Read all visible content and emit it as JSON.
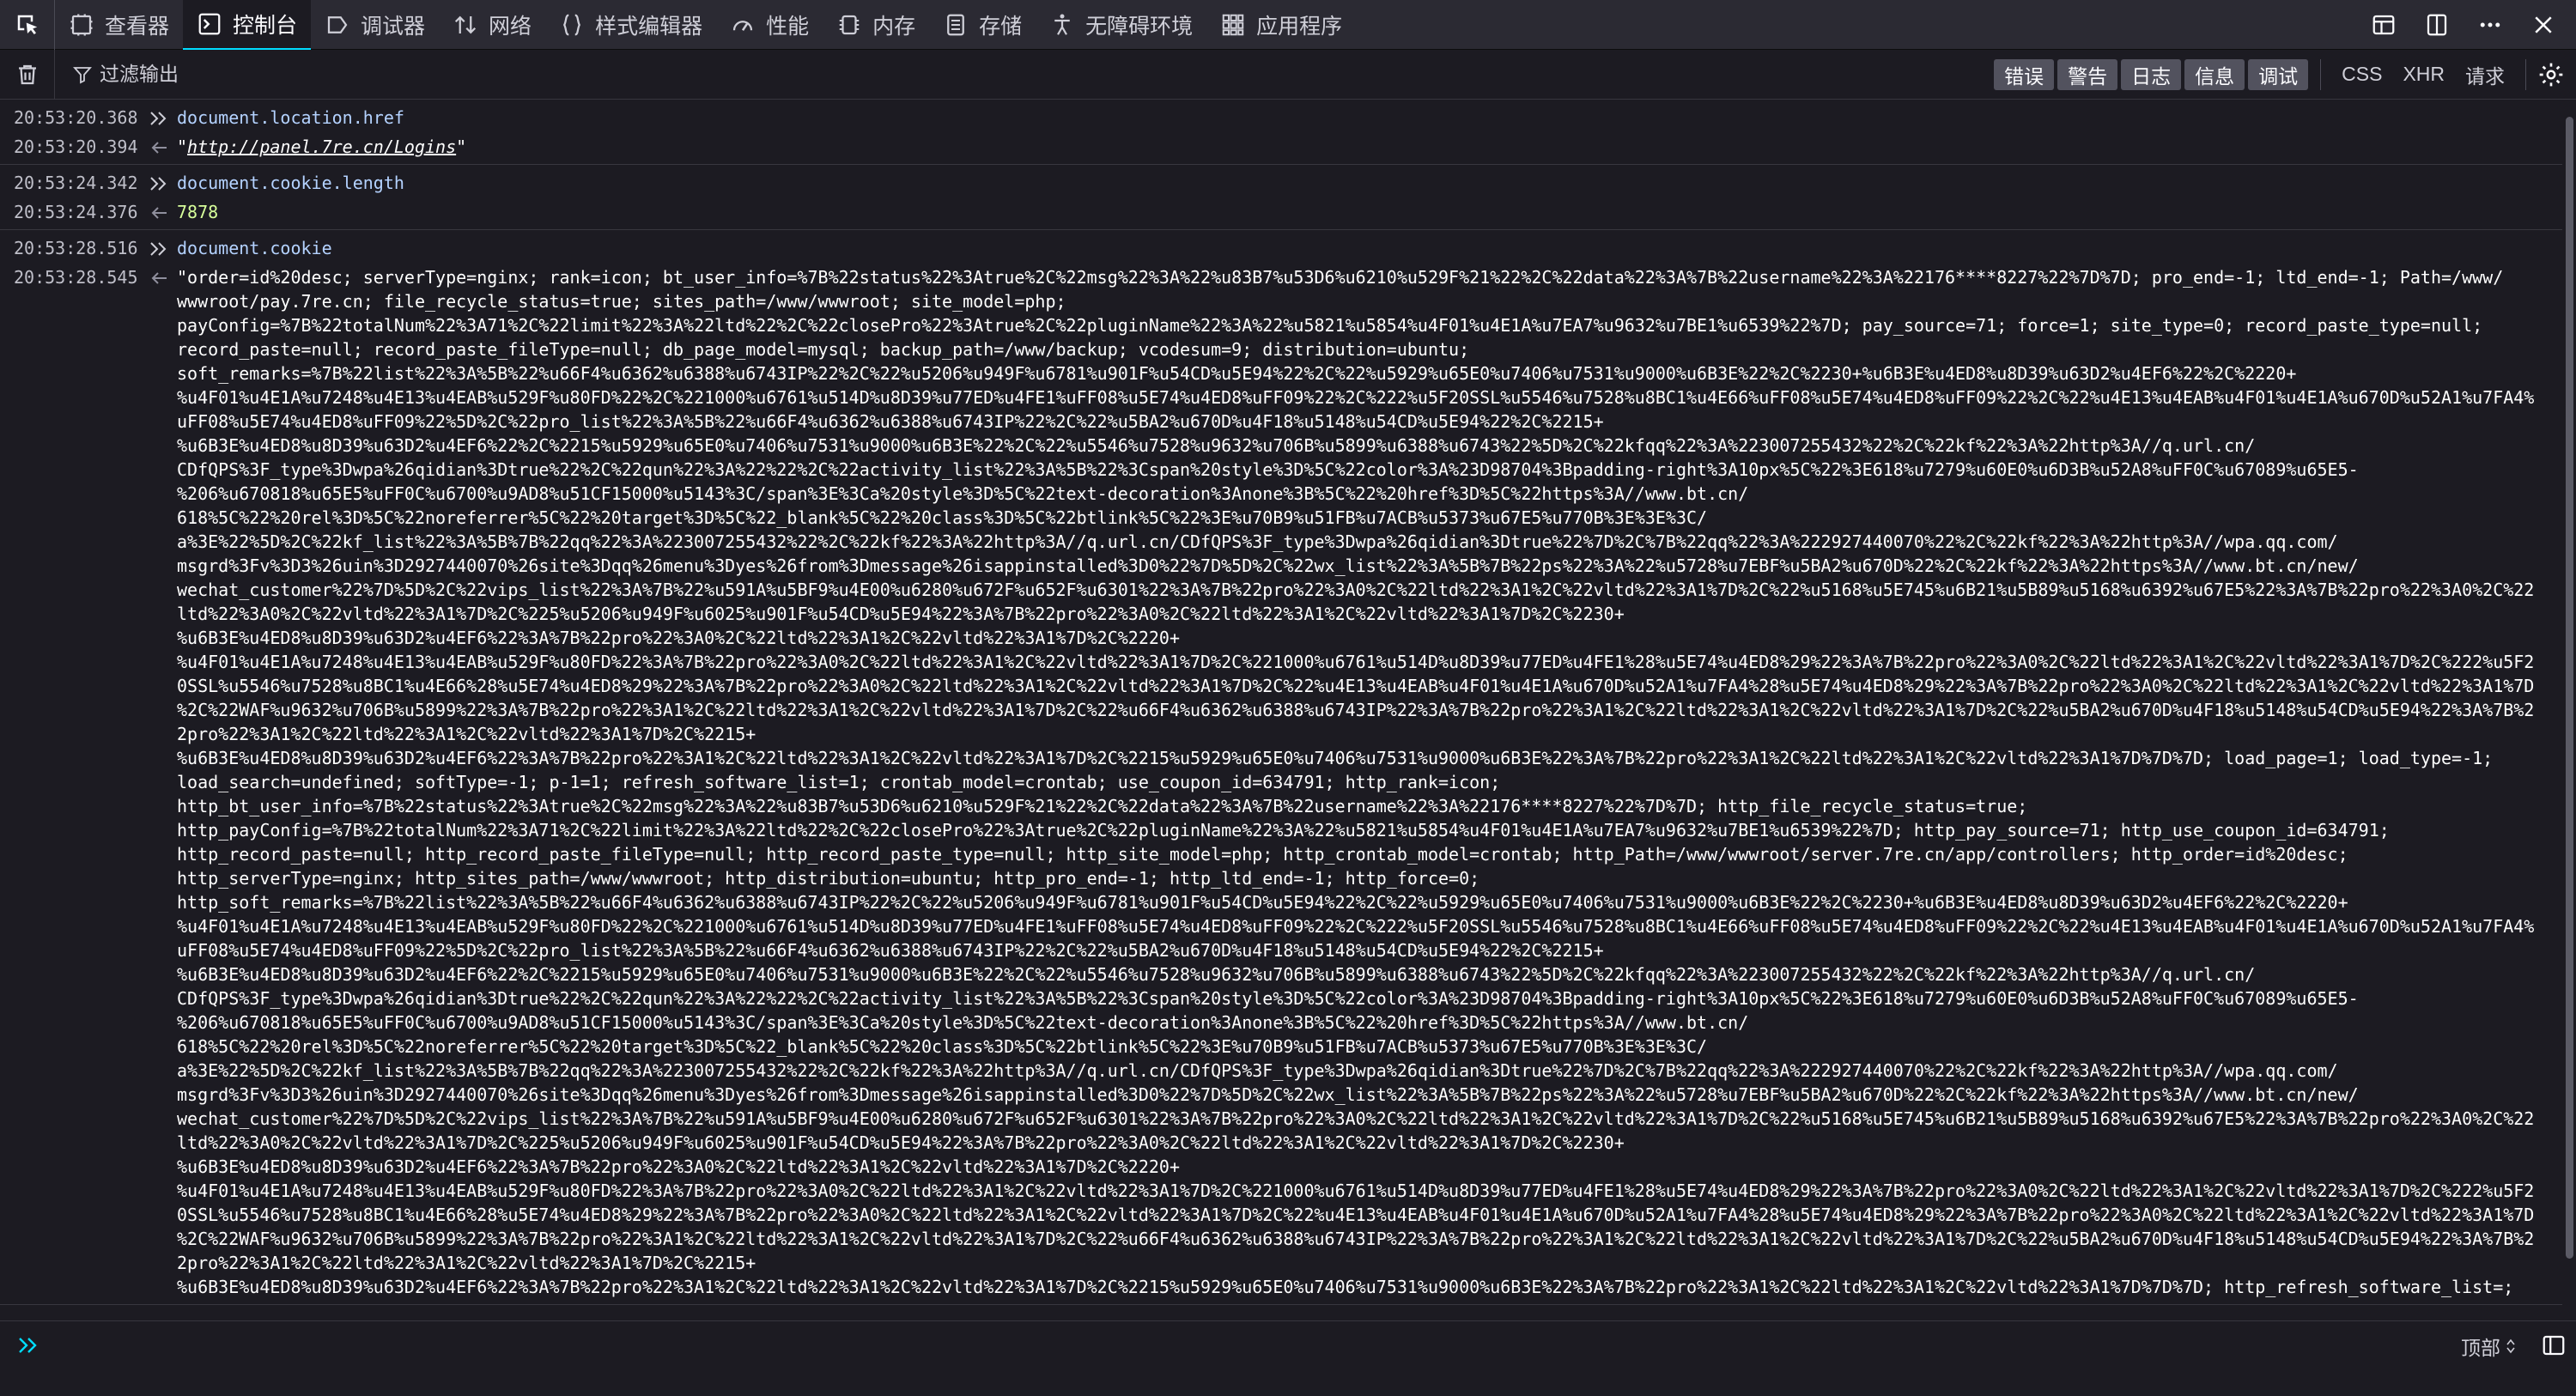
{
  "toolbar": {
    "tabs": [
      {
        "label": "查看器",
        "icon": "inspector-icon"
      },
      {
        "label": "控制台",
        "icon": "console-icon"
      },
      {
        "label": "调试器",
        "icon": "debugger-icon"
      },
      {
        "label": "网络",
        "icon": "network-icon"
      },
      {
        "label": "样式编辑器",
        "icon": "style-editor-icon"
      },
      {
        "label": "性能",
        "icon": "performance-icon"
      },
      {
        "label": "内存",
        "icon": "memory-icon"
      },
      {
        "label": "存储",
        "icon": "storage-icon"
      },
      {
        "label": "无障碍环境",
        "icon": "accessibility-icon"
      },
      {
        "label": "应用程序",
        "icon": "application-icon"
      }
    ],
    "selected_tab": "控制台"
  },
  "filterbar": {
    "placeholder": "过滤输出",
    "levels": [
      "错误",
      "警告",
      "日志",
      "信息",
      "调试"
    ],
    "requests": [
      "CSS",
      "XHR",
      "请求"
    ]
  },
  "messages": [
    {
      "time": "20:53:20.368",
      "kind": "input",
      "text": "document.location.href"
    },
    {
      "time": "20:53:20.394",
      "kind": "result-link",
      "text": "\"http://panel.7re.cn/Logins\"",
      "link": "http://panel.7re.cn/Logins"
    },
    {
      "time": "20:53:24.342",
      "kind": "input",
      "text": "document.cookie.length"
    },
    {
      "time": "20:53:24.376",
      "kind": "result-num",
      "text": "7878"
    },
    {
      "time": "20:53:28.516",
      "kind": "input",
      "text": "document.cookie"
    },
    {
      "time": "20:53:28.545",
      "kind": "result-str",
      "lines": [
        "\"order=id%20desc; serverType=nginx; rank=icon; bt_user_info=%7B%22status%22%3Atrue%2C%22msg%22%3A%22%u83B7%u53D6%u6210%u529F%21%22%2C%22data%22%3A%7B%22username%22%3A%22176****8227%22%7D%7D; pro_end=-1; ltd_end=-1; Path=/www/",
        "wwwroot/pay.7re.cn; file_recycle_status=true; sites_path=/www/wwwroot; site_model=php;",
        "payConfig=%7B%22totalNum%22%3A71%2C%22limit%22%3A%22ltd%22%2C%22closePro%22%3Atrue%2C%22pluginName%22%3A%22%u5821%u5854%u4F01%u4E1A%u7EA7%u9632%u7BE1%u6539%22%7D; pay_source=71; force=1; site_type=0; record_paste_type=null;",
        "record_paste=null; record_paste_fileType=null; db_page_model=mysql; backup_path=/www/backup; vcodesum=9; distribution=ubuntu;",
        "soft_remarks=%7B%22list%22%3A%5B%22%u66F4%u6362%u6388%u6743IP%22%2C%22%u5206%u949F%u6781%u901F%u54CD%u5E94%22%2C%22%u5929%u65E0%u7406%u7531%u9000%u6B3E%22%2C%2230+%u6B3E%u4ED8%u8D39%u63D2%u4EF6%22%2C%2220+",
        "%u4F01%u4E1A%u7248%u4E13%u4EAB%u529F%u80FD%22%2C%221000%u6761%u514D%u8D39%u77ED%u4FE1%uFF08%u5E74%u4ED8%uFF09%22%2C%222%u5F20SSL%u5546%u7528%u8BC1%u4E66%uFF08%u5E74%u4ED8%uFF09%22%2C%22%u4E13%u4EAB%u4F01%u4E1A%u670D%u52A1%u7FA4%",
        "uFF08%u5E74%u4ED8%uFF09%22%5D%2C%22pro_list%22%3A%5B%22%u66F4%u6362%u6388%u6743IP%22%2C%22%u5BA2%u670D%u4F18%u5148%u54CD%u5E94%22%2C%2215+",
        "%u6B3E%u4ED8%u8D39%u63D2%u4EF6%22%2C%2215%u5929%u65E0%u7406%u7531%u9000%u6B3E%22%2C%22%u5546%u7528%u9632%u706B%u5899%u6388%u6743%22%5D%2C%22kfqq%22%3A%223007255432%22%2C%22kf%22%3A%22http%3A//q.url.cn/",
        "CDfQPS%3F_type%3Dwpa%26qidian%3Dtrue%22%2C%22qun%22%3A%22%22%2C%22activity_list%22%3A%5B%22%3Cspan%20style%3D%5C%22color%3A%23D98704%3Bpadding-right%3A10px%5C%22%3E618%u7279%u60E0%u6D3B%u52A8%uFF0C%u67089%u65E5-",
        "%206%u670818%u65E5%uFF0C%u6700%u9AD8%u51CF15000%u5143%3C/span%3E%3Ca%20style%3D%5C%22text-decoration%3Anone%3B%5C%22%20href%3D%5C%22https%3A//www.bt.cn/",
        "618%5C%22%20rel%3D%5C%22noreferrer%5C%22%20target%3D%5C%22_blank%5C%22%20class%3D%5C%22btlink%5C%22%3E%u70B9%u51FB%u7ACB%u5373%u67E5%u770B%3E%3E%3C/",
        "a%3E%22%5D%2C%22kf_list%22%3A%5B%7B%22qq%22%3A%22300725543​2%22%2C%22kf%22%3A%22http%3A//q.url.cn/CDfQPS%3F_type%3Dwpa%26qidian%3Dtrue%22%7D%2C%7B%22qq%22%3A%222927440070%22%2C%22kf%22%3A%22http%3A//wpa.qq.com/",
        "msgrd%3Fv%3D3%26uin%3D2927440070%26site%3Dqq%26menu%3Dyes%26from%3Dmessage%26isappinstalled%3D0%22%7D%5D%2C%22wx_list%22%3A%5B%7B%22ps%22%3A%22%u5728%u7EBF%u5BA2%u670D%22%2C%22kf%22%3A%22https%3A//www.bt.cn/new/",
        "wechat_customer%22%7D%5D%2C%22vips_list%22%3A%7B%22%u591A%u5BF9%u4E00%u6280%u672F%u652F%u6301%22%3A%7B%22pro%22%3A0%2C%22ltd%22%3A1%2C%22vltd%22%3A1%7D%2C%22%u5168%u5E745%u6B21%u5B89%u5168%u6392%u67E5%22%3A%7B%22pro%22%3A0%2C%22",
        "ltd%22%3A0%2C%22vltd%22%3A1%7D%2C%225%u5206%u949F%u6025%u901F%u54CD%u5E94%22%3A%7B%22pro%22%3A0%2C%22ltd%22%3A1%2C%22vltd%22%3A1%7D%2C%2230+",
        "%u6B3E%u4ED8%u8D39%u63D2%u4EF6%22%3A%7B%22pro%22%3A0%2C%22ltd%22%3A1%2C%22vltd%22%3A1%7D%2C%2220+",
        "%u4F01%u4E1A%u7248%u4E13%u4EAB%u529F%u80FD%22%3A%7B%22pro%22%3A0%2C%22ltd%22%3A1%2C%22vltd%22%3A1%7D%2C%221000%u6761%u514D%u8D39%u77ED%u4FE1%28%u5E74%u4ED8%29%22%3A%7B%22pro%22%3A0%2C%22ltd%22%3A1%2C%22vltd%22%3A1%7D%2C%222%u5F2",
        "0SSL%u5546%u7528%u8BC1%u4E66%28%u5E74%u4ED8%29%22%3A%7B%22pro%22%3A0%2C%22ltd%22%3A1%2C%22vltd%22%3A1%7D%2C%22%u4E13%u4EAB%u4F01%u4E1A%u670D%u52A1%u7FA4%28%u5E74%u4ED8%29%22%3A%7B%22pro%22%3A0%2C%22ltd%22%3A1%2C%22vltd%22%3A1%7D",
        "%2C%22WAF%u9632%u706B%u5899%22%3A%7B%22pro%22%3A1%2C%22ltd%22%3A1%2C%22vltd%22%3A1%7D%2C%22%u66F4%u6362%u6388%u6743IP%22%3A%7B%22pro%22%3A1%2C%22ltd%22%3A1%2C%22vltd%22%3A1%7D%2C%22%u5BA2%u670D%u4F18%u5148%u54CD%u5E94%22%3A%7B%2",
        "2pro%22%3A1%2C%22ltd%22%3A1%2C%22vltd%22%3A1%7D%2C%2215+",
        "%u6B3E%u4ED8%u8D39%u63D2%u4EF6%22%3A%7B%22pro%22%3A1%2C%22ltd%22%3A1%2C%22vltd%22%3A1%7D%2C%2215%u5929%u65E0%u7406%u7531%u9000%u6B3E%22%3A%7B%22pro%22%3A1%2C%22ltd%22%3A1%2C%22vltd%22%3A1%7D%7D%7D; load_page=1; load_type=-1;",
        "load_search=undefined; softType=-1; p-1=1; refresh_software_list=1; crontab_model=crontab; use_coupon_id=634791; http_rank=icon;",
        "http_bt_user_info=%7B%22status%22%3Atrue%2C%22msg%22%3A%22%u83B7%u53D6%u6210%u529F%21%22%2C%22data%22%3A%7B%22username%22%3A%22176****8227%22%7D%7D; http_file_recycle_status=true;",
        "http_payConfig=%7B%22totalNum%22%3A71%2C%22limit%22%3A%22ltd%22%2C%22closePro%22%3Atrue%2C%22pluginName%22%3A%22%u5821%u5854%u4F01%u4E1A%u7EA7%u9632%u7BE1%u6539%22%7D; http_pay_source=71; http_use_coupon_id=634791;",
        "http_record_paste=null; http_record_paste_fileType=null; http_record_paste_type=null; http_site_model=php; http_crontab_model=crontab; http_Path=/www/wwwroot/server.7re.cn/app/controllers; http_order=id%20desc;",
        "http_serverType=nginx; http_sites_path=/www/wwwroot; http_distribution=ubuntu; http_pro_end=-1; http_ltd_end=-1; http_force=0;",
        "http_soft_remarks=%7B%22list%22%3A%5B%22%u66F4%u6362%u6388%u6743IP%22%2C%22%u5206%u949F%u6781%u901F%u54CD%u5E94%22%2C%22%u5929%u65E0%u7406%u7531%u9000%u6B3E%22%2C%2230+%u6B3E%u4ED8%u8D39%u63D2%u4EF6%22%2C%2220+",
        "%u4F01%u4E1A%u7248%u4E13%u4EAB%u529F%u80FD%22%2C%221000%u6761%u514D%u8D39%u77ED%u4FE1%uFF08%u5E74%u4ED8%uFF09%22%2C%222%u5F20SSL%u5546%u7528%u8BC1%u4E66%uFF08%u5E74%u4ED8%uFF09%22%2C%22%u4E13%u4EAB%u4F01%u4E1A%u670D%u52A1%u7FA4%",
        "uFF08%u5E74%u4ED8%uFF09%22%5D%2C%22pro_list%22%3A%5B%22%u66F4%u6362%u6388%u6743IP%22%2C%22%u5BA2%u670D%u4F18%u5148%u54CD%u5E94%22%2C%2215+",
        "%u6B3E%u4ED8%u8D39%u63D2%u4EF6%22%2C%2215%u5929%u65E0%u7406%u7531%u9000%u6B3E%22%2C%22%u5546%u7528%u9632%u706B%u5899%u6388%u6743%22%5D%2C%22kfqq%22%3A%223007255432%22%2C%22kf%22%3A%22http%3A//q.url.cn/",
        "CDfQPS%3F_type%3Dwpa%26qidian%3Dtrue%22%2C%22qun%22%3A%22%22%2C%22activity_list%22%3A%5B%22%3Cspan%20style%3D%5C%22color%3A%23D98704%3Bpadding-right%3A10px%5C%22%3E618%u7279%u60E0%u6D3B%u52A8%uFF0C%u67089%u65E5-",
        "%206%u670818%u65E5%uFF0C%u6700%u9AD8%u51CF15000%u5143%3C/span%3E%3Ca%20style%3D%5C%22text-decoration%3Anone%3B%5C%22%20href%3D%5C%22https%3A//www.bt.cn/",
        "618%5C%22%20rel%3D%5C%22noreferrer%5C%22%20target%3D%5C%22_blank%5C%22%20class%3D%5C%22btlink%5C%22%3E%u70B9%u51FB%u7ACB%u5373%u67E5%u770B%3E%3E%3C/",
        "a%3E%22%5D%2C%22kf_list%22%3A%5B%7B%22qq%22%3A%223007255432%22%2C%22kf%22%3A%22http%3A//q.url.cn/CDfQPS%3F_type%3Dwpa%26qidian%3Dtrue%22%7D%2C%7B%22qq%22%3A%222927440070%22%2C%22kf%22%3A%22http%3A//wpa.qq.com/",
        "msgrd%3Fv%3D3%26uin%3D2927440070%26site%3Dqq%26menu%3Dyes%26from%3Dmessage%26isappinstalled%3D0%22%7D%5D%2C%22wx_list%22%3A%5B%7B%22ps%22%3A%22%u5728%u7EBF%u5BA2%u670D%22%2C%22kf%22%3A%22https%3A//www.bt.cn/new/",
        "wechat_customer%22%7D%5D%2C%22vips_list%22%3A%7B%22%u591A%u5BF9%u4E00%u6280%u672F%u652F%u6301%22%3A%7B%22pro%22%3A0%2C%22ltd%22%3A1%2C%22vltd%22%3A1%7D%2C%22%u5168%u5E745%u6B21%u5B89%u5168%u6392%u67E5%22%3A%7B%22pro%22%3A0%2C%22",
        "ltd%22%3A0%2C%22vltd%22%3A1%7D%2C%225%u5206%u949F%u6025%u901F%u54CD%u5E94%22%3A%7B%22pro%22%3A0%2C%22ltd%22%3A1%2C%22vltd%22%3A1%7D%2C%2230+",
        "%u6B3E%u4ED8%u8D39%u63D2%u4EF6%22%3A%7B%22pro%22%3A0%2C%22ltd%22%3A1%2C%22vltd%22%3A1%7D%2C%2220+",
        "%u4F01%u4E1A%u7248%u4E13%u4EAB%u529F%u80FD%22%3A%7B%22pro%22%3A0%2C%22ltd%22%3A1%2C%22vltd%22%3A1%7D%2C%221000%u6761%u514D%u8D39%u77ED%u4FE1%28%u5E74%u4ED8%29%22%3A%7B%22pro%22%3A0%2C%22ltd%22%3A1%2C%22vltd%22%3A1%7D%2C%222%u5F2",
        "0SSL%u5546%u7528%u8BC1%u4E66%28%u5E74%u4ED8%29%22%3A%7B%22pro%22%3A0%2C%22ltd%22%3A1%2C%22vltd%22%3A1%7D%2C%22%u4E13%u4EAB%u4F01%u4E1A%u670D%u52A1%u7FA4%28%u5E74%u4ED8%29%22%3A%7B%22pro%22%3A0%2C%22ltd%22%3A1%2C%22vltd%22%3A1%7D",
        "%2C%22WAF%u9632%u706B%u5899%22%3A%7B%22pro%22%3A1%2C%22ltd%22%3A1%2C%22vltd%22%3A1%7D%2C%22%u66F4%u6362%u6388%u6743IP%22%3A%7B%22pro%22%3A1%2C%22ltd%22%3A1%2C%22vltd%22%3A1%7D%2C%22%u5BA2%u670D%u4F18%u5148%u54CD%u5E94%22%3A%7B%2",
        "2pro%22%3A1%2C%22ltd%22%3A1%2C%22vltd%22%3A1%7D%2C%2215+",
        "%u6B3E%u4ED8%u8D39%u63D2%u4EF6%22%3A%7B%22pro%22%3A1%2C%22ltd%22%3A1%2C%22vltd%22%3A1%7D%2C%2215%u5929%u65E0%u7406%u7531%u9000%u6B3E%22%3A%7B%22pro%22%3A1%2C%22ltd%22%3A1%2C%22vltd%22%3A1%7D%7D%7D; http_refresh_software_list=;"
      ]
    }
  ],
  "inputbar": {
    "context": "顶部"
  },
  "colors": {
    "toolbar_bg": "#2b2a33",
    "panel_bg": "#1c1b22",
    "accent": "#00ddff",
    "input_code": "#b4d2ff",
    "result_number": "#d7ff9b"
  }
}
